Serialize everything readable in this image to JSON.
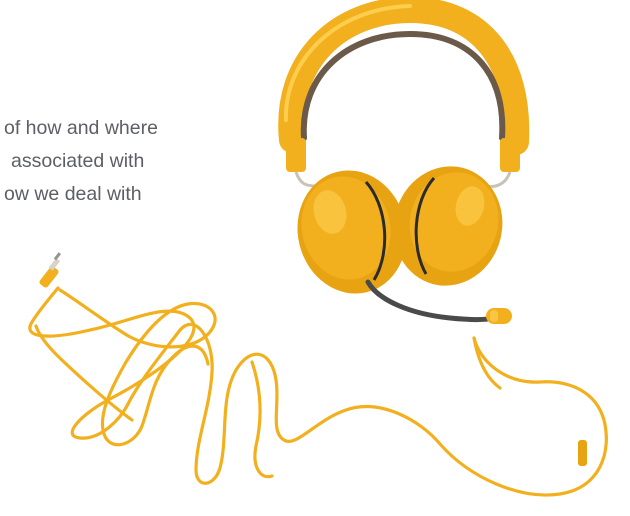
{
  "copy": {
    "line1": "of how and where",
    "line2": "associated with",
    "line3": "ow we deal with"
  },
  "photo": {
    "subject": "headphones-with-cable",
    "colors": {
      "body": "#f2b01e",
      "body_shade": "#d98f0a",
      "highlight": "#ffd45a",
      "inner_band": "#6b5a4a",
      "mic_arm": "#4a4a4a",
      "metal": "#c8c2b8"
    }
  }
}
